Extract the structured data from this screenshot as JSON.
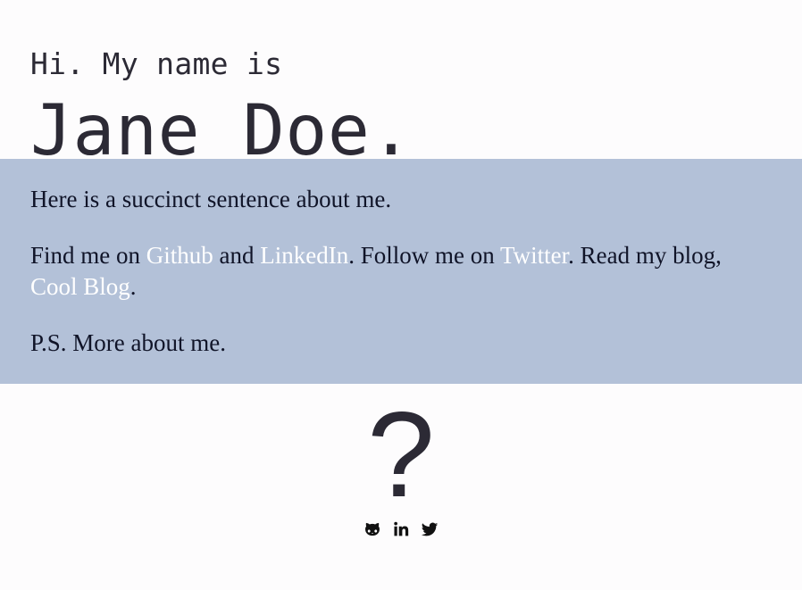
{
  "intro": {
    "greeting": "Hi. My name is",
    "name": "Jane Doe."
  },
  "about": {
    "sentence": "Here is a succinct sentence about me.",
    "links_paragraph": {
      "find_me_on": "Find me on",
      "github": "Github",
      "and": "and",
      "linkedin": "LinkedIn",
      "follow_me_on": ". Follow me on",
      "twitter": "Twitter",
      "read_my_blog": ". Read my blog,",
      "cool_blog": "Cool Blog",
      "period": "."
    },
    "postscript": "P.S. More about me."
  },
  "footer": {
    "question_mark": "?",
    "social_icons": [
      "github-icon",
      "linkedin-icon",
      "twitter-icon"
    ]
  },
  "colors": {
    "background": "#fdfcfd",
    "band": "#b3c1d8",
    "text": "#2c2a35",
    "link": "#ffffff"
  }
}
